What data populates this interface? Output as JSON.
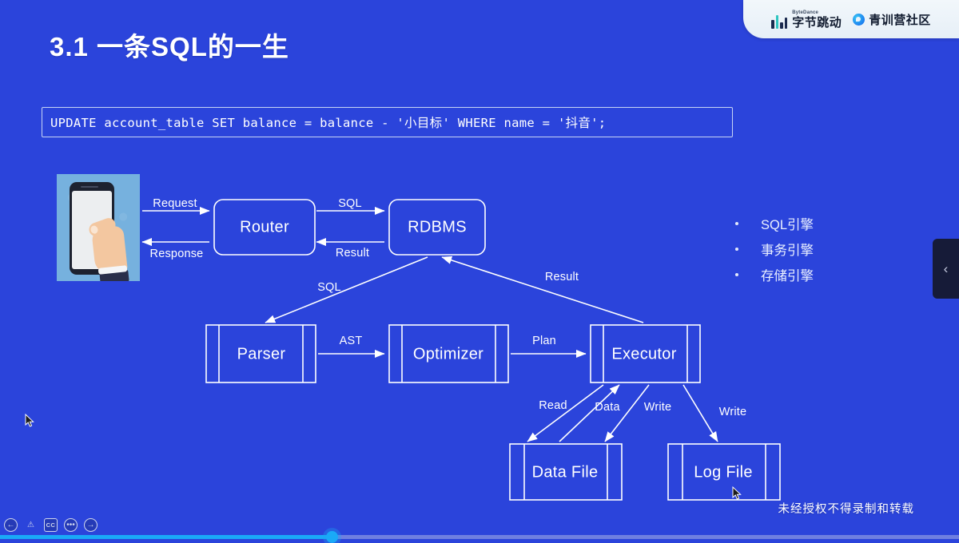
{
  "slide": {
    "title": "3.1 一条SQL的一生",
    "background_color": "#2b44db",
    "sql_statement": "UPDATE account_table SET balance = balance - '小目标' WHERE name = '抖音';",
    "watermark": "未经授权不得录制和转载"
  },
  "brand": {
    "bytedance_en": "ByteDance",
    "bytedance_cn": "字节跳动",
    "community_cn": "青训营社区"
  },
  "diagram": {
    "nodes": [
      {
        "id": "client",
        "label": "",
        "shape": "image"
      },
      {
        "id": "router",
        "label": "Router",
        "shape": "rounded"
      },
      {
        "id": "rdbms",
        "label": "RDBMS",
        "shape": "rounded"
      },
      {
        "id": "parser",
        "label": "Parser",
        "shape": "process"
      },
      {
        "id": "optimizer",
        "label": "Optimizer",
        "shape": "process"
      },
      {
        "id": "executor",
        "label": "Executor",
        "shape": "process"
      },
      {
        "id": "datafile",
        "label": "Data File",
        "shape": "process"
      },
      {
        "id": "logfile",
        "label": "Log File",
        "shape": "process"
      }
    ],
    "edges": [
      {
        "from": "client",
        "to": "router",
        "label": "Request"
      },
      {
        "from": "router",
        "to": "client",
        "label": "Response"
      },
      {
        "from": "router",
        "to": "rdbms",
        "label": "SQL"
      },
      {
        "from": "rdbms",
        "to": "router",
        "label": "Result"
      },
      {
        "from": "rdbms",
        "to": "parser",
        "label": "SQL"
      },
      {
        "from": "executor",
        "to": "rdbms",
        "label": "Result"
      },
      {
        "from": "parser",
        "to": "optimizer",
        "label": "AST"
      },
      {
        "from": "optimizer",
        "to": "executor",
        "label": "Plan"
      },
      {
        "from": "executor",
        "to": "datafile",
        "label": "Read"
      },
      {
        "from": "datafile",
        "to": "executor",
        "label": "Data"
      },
      {
        "from": "executor",
        "to": "datafile",
        "label": "Write"
      },
      {
        "from": "executor",
        "to": "logfile",
        "label": "Write"
      }
    ]
  },
  "bullets": [
    {
      "label": "SQL引擎"
    },
    {
      "label": "事务引擎"
    },
    {
      "label": "存储引擎"
    }
  ],
  "side_panel": {
    "chevron": "‹"
  },
  "player": {
    "controls": [
      {
        "name": "replay",
        "glyph": "←"
      },
      {
        "name": "warning",
        "glyph": "⚠"
      },
      {
        "name": "captions",
        "glyph": "CC"
      },
      {
        "name": "more",
        "glyph": "•••"
      },
      {
        "name": "forward",
        "glyph": "→"
      }
    ]
  }
}
